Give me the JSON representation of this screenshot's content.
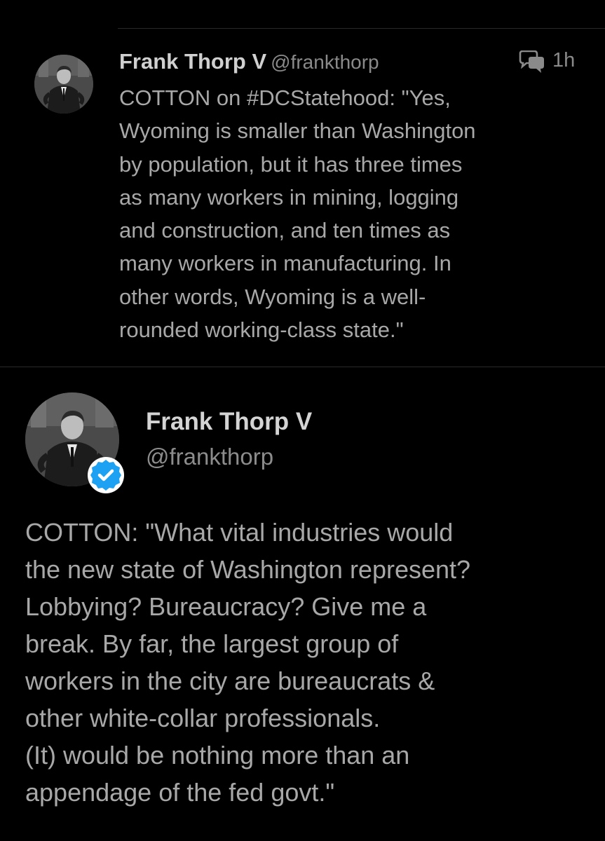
{
  "tweet1": {
    "avatar_icon": "profile-photo-man-in-suit",
    "name": "Frank Thorp V",
    "handle": "@frankthorp",
    "conversation_icon": "conversation-bubbles-icon",
    "time": "1h",
    "text_prefix": "COTTON on ",
    "hashtag": "#DCStatehood",
    "text_lines": ": \"Yes,\nWyoming is smaller than Washington\nby population, but it has three times\nas many workers in mining, logging\nand construction, and ten times as\nmany workers in manufacturing. In\nother words, Wyoming is a well-\nrounded working-class state.\""
  },
  "tweet2": {
    "avatar_icon": "profile-photo-man-in-suit",
    "verified_icon": "verified-badge-icon",
    "name": "Frank Thorp V",
    "handle": "@frankthorp",
    "text": "COTTON: \"What vital industries would\nthe new state of Washington represent?\nLobbying? Bureaucracy? Give me a\nbreak. By far, the largest group of\nworkers in the city are bureaucrats &\nother white-collar professionals.\n(It) would be nothing more than an\nappendage of the fed govt.\""
  },
  "colors": {
    "background": "#000000",
    "text": "#a8a8a8",
    "name": "#d0d0d0",
    "handle": "#8a8a8a",
    "verified": "#1da1f2",
    "divider": "#2a2a2a"
  }
}
